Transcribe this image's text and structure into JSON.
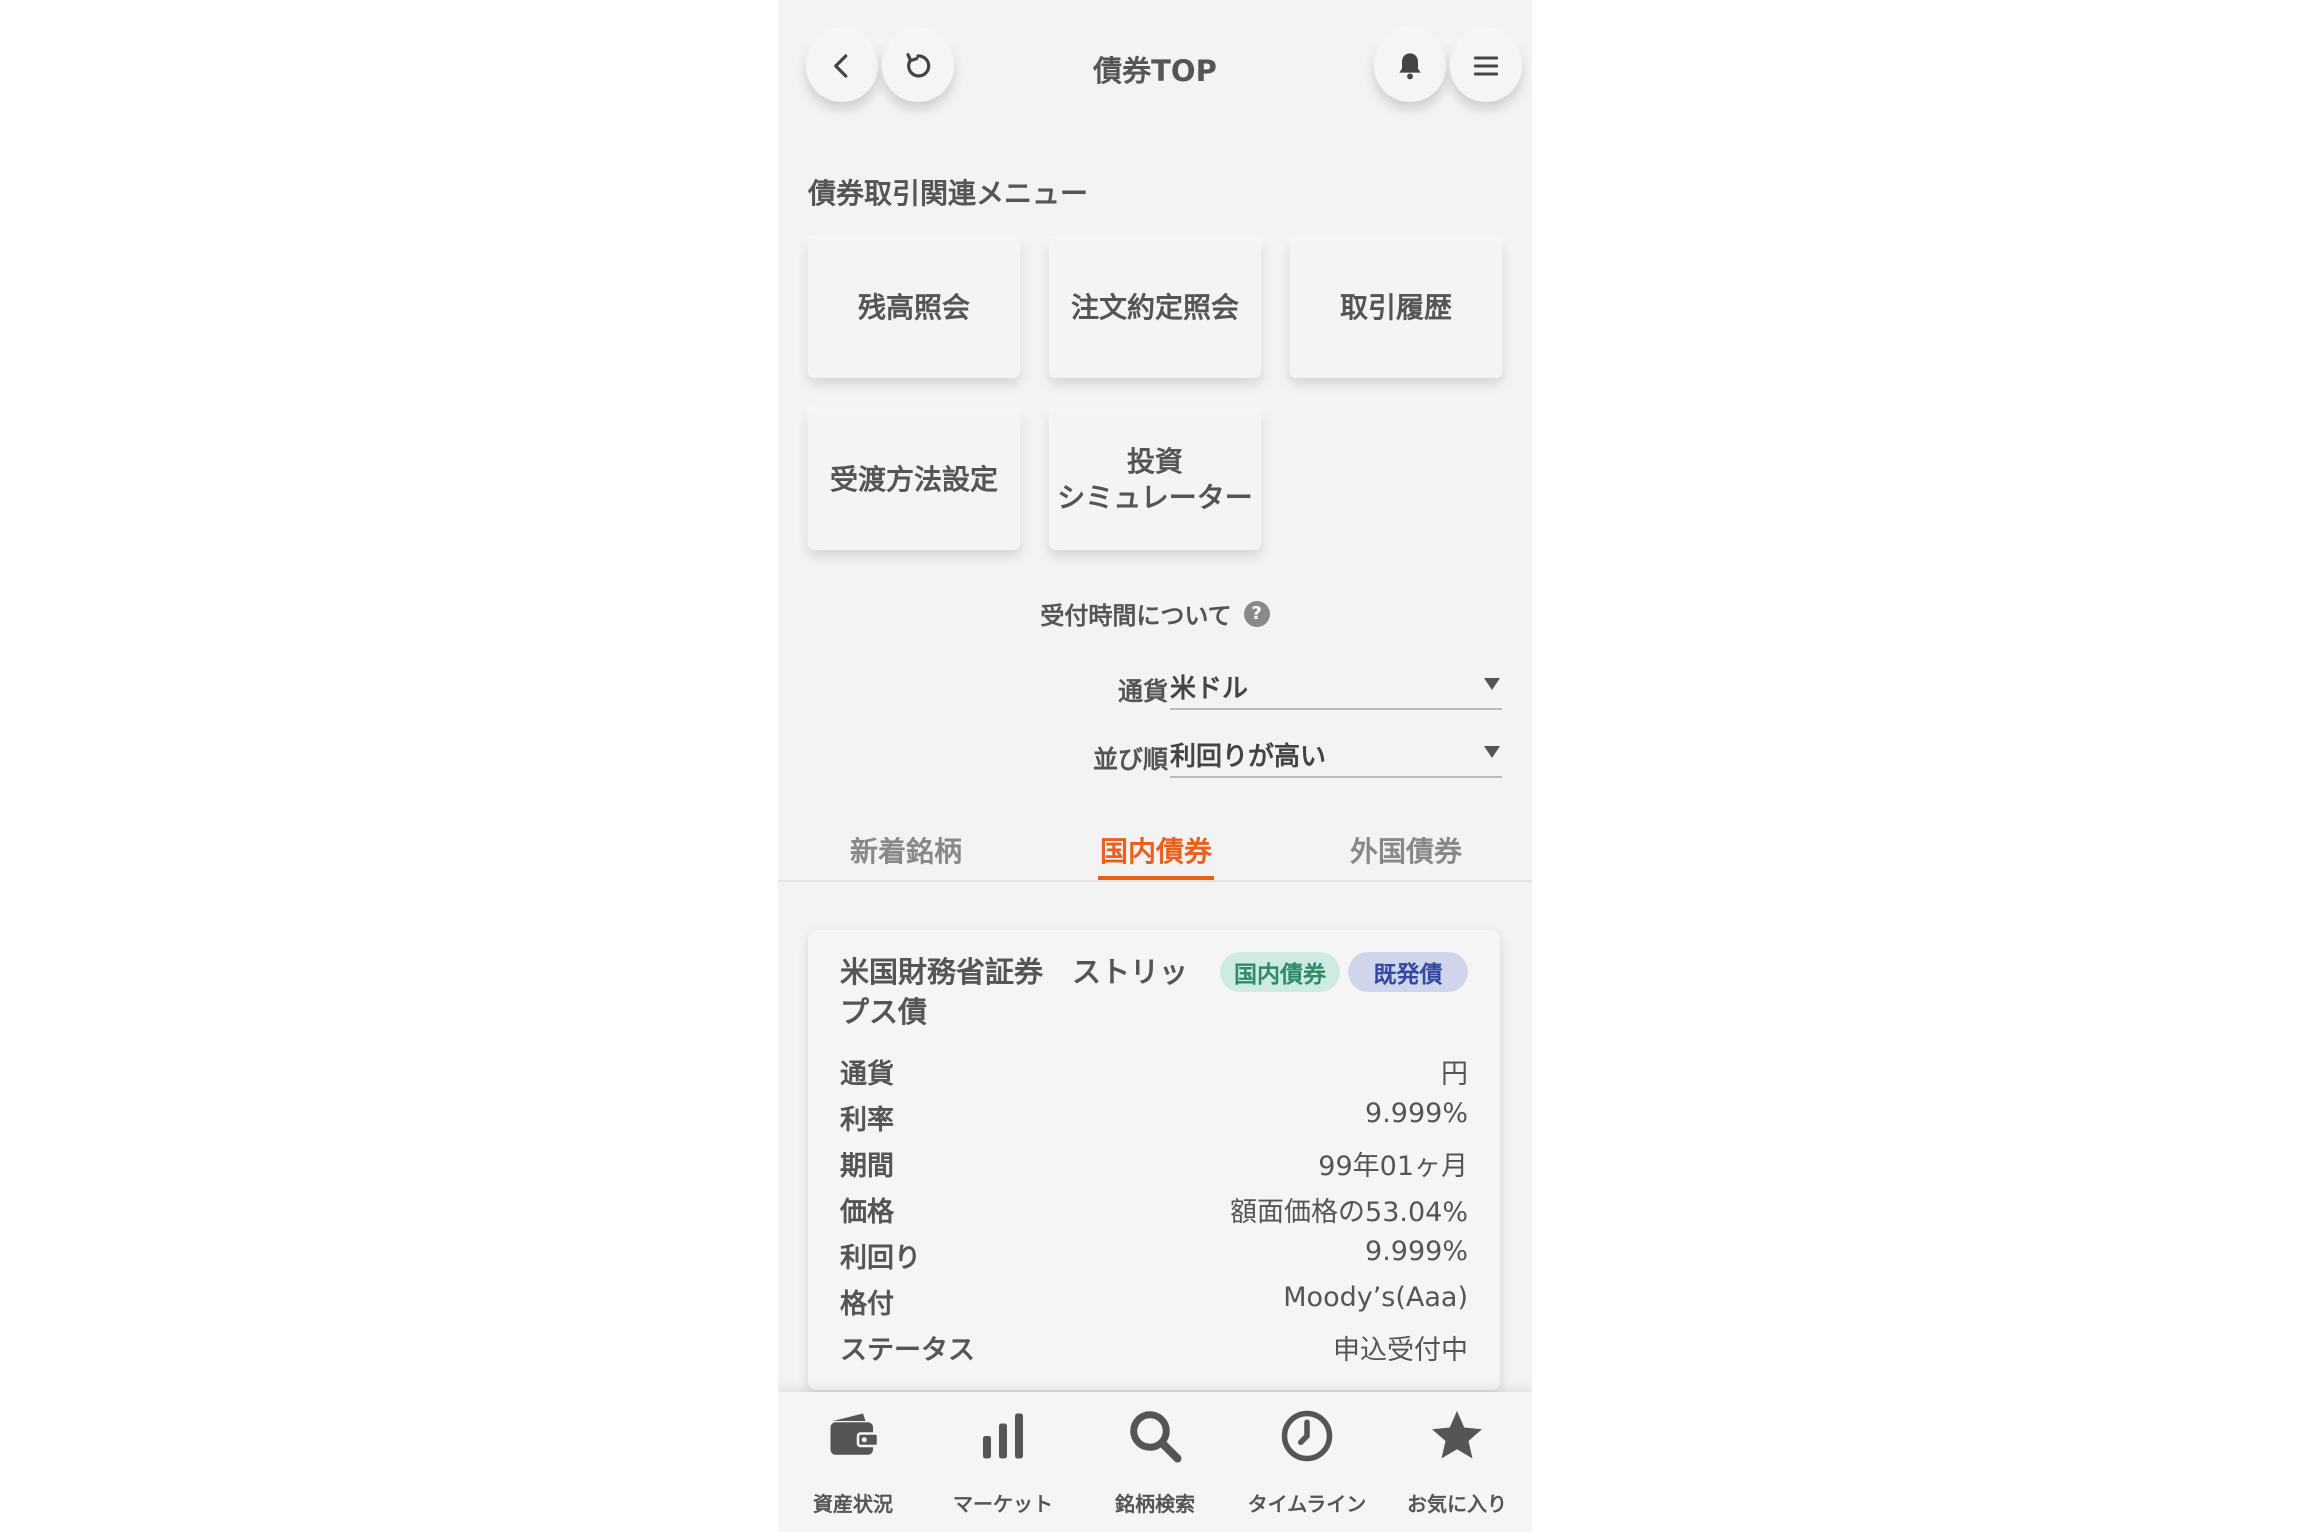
{
  "header": {
    "title": "債券TOP"
  },
  "menu_section": {
    "title": "債券取引関連メニュー",
    "items": [
      {
        "label": "残高照会"
      },
      {
        "label": "注文約定照会"
      },
      {
        "label": "取引履歴"
      },
      {
        "label": "受渡方法設定"
      },
      {
        "label_line1": "投資",
        "label_line2": "シミュレーター"
      }
    ]
  },
  "reception": {
    "label": "受付時間について",
    "help": "?"
  },
  "filters": {
    "currency": {
      "label": "通貨",
      "value": "米ドル"
    },
    "sort": {
      "label": "並び順",
      "value": "利回りが高い"
    }
  },
  "tabs": [
    {
      "label": "新着銘柄",
      "active": false
    },
    {
      "label": "国内債券",
      "active": true
    },
    {
      "label": "外国債券",
      "active": false
    }
  ],
  "bond_card": {
    "title_line1": "米国財務省証券　ストリッ",
    "title_line2": "プス債",
    "badges": [
      "国内債券",
      "既発債"
    ],
    "rows": [
      {
        "key": "通貨",
        "value": "円"
      },
      {
        "key": "利率",
        "value": "9.999%"
      },
      {
        "key": "期間",
        "value": "99年01ヶ月"
      },
      {
        "key": "価格",
        "value": "額面価格の53.04%"
      },
      {
        "key": "利回り",
        "value": "9.999%"
      },
      {
        "key": "格付",
        "value": "Moody’s(Aaa)"
      },
      {
        "key": "ステータス",
        "value": "申込受付中"
      }
    ]
  },
  "bottom_nav": [
    {
      "label": "資産状況",
      "icon": "wallet-icon"
    },
    {
      "label": "マーケット",
      "icon": "bar-chart-icon"
    },
    {
      "label": "銘柄検索",
      "icon": "search-icon"
    },
    {
      "label": "タイムライン",
      "icon": "clock-icon"
    },
    {
      "label": "お気に入り",
      "icon": "star-icon"
    }
  ],
  "colors": {
    "accent": "#e8601c",
    "background": "#f3f3f3",
    "badge_domestic": "#cdebe2",
    "badge_existing": "#cfd6ec"
  }
}
